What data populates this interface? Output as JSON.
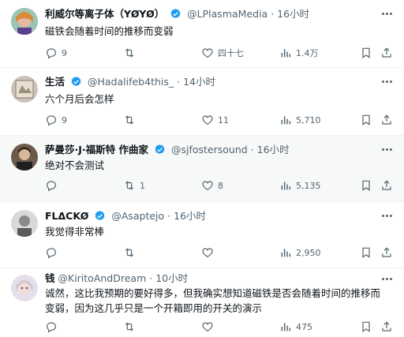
{
  "posts": [
    {
      "name": "利威尔等离子体（YØYØ）",
      "handle": "@LPlasmaMedia",
      "dot": "·",
      "time": "16小时",
      "text": [
        "磁铁会随着时间的推移而变弱"
      ],
      "replies": "9",
      "reposts": "",
      "likes": "四十七",
      "views": "1.4万"
    },
    {
      "name": "生活",
      "handle": "@Hadalifeb4this_",
      "dot": "·",
      "time": "14小时",
      "text": [
        "六个月后会怎样"
      ],
      "replies": "9",
      "reposts": "",
      "likes": "11",
      "views": "5,710"
    },
    {
      "name": "萨曼莎·J·福斯特 作曲家",
      "handle": "@sjfostersound",
      "dot": "·",
      "time": "16小时",
      "text": [
        "绝对不会测试"
      ],
      "replies": "",
      "reposts": "1",
      "likes": "8",
      "views": "5,135"
    },
    {
      "name": "FLΔCKØ",
      "handle": "@Asaptejo",
      "dot": "·",
      "time": "16小时",
      "text": [
        "我觉得非常棒"
      ],
      "replies": "",
      "reposts": "",
      "likes": "",
      "views": "2,950"
    },
    {
      "name": "钱",
      "handle": "@KiritoAndDream",
      "dot": "·",
      "time": "10小时",
      "text": [
        "诚然，这比我预期的要好得多，但我确实想知道磁铁是否会随着时间的推移而",
        "变弱，因为这几乎只是一个开箱即用的开关的演示"
      ],
      "replies": "",
      "reposts": "",
      "likes": "",
      "views": "475"
    }
  ],
  "colors": {
    "verified": "#1d9bf0",
    "icon": "#536471",
    "hover_bg": "#f7f9f9"
  }
}
